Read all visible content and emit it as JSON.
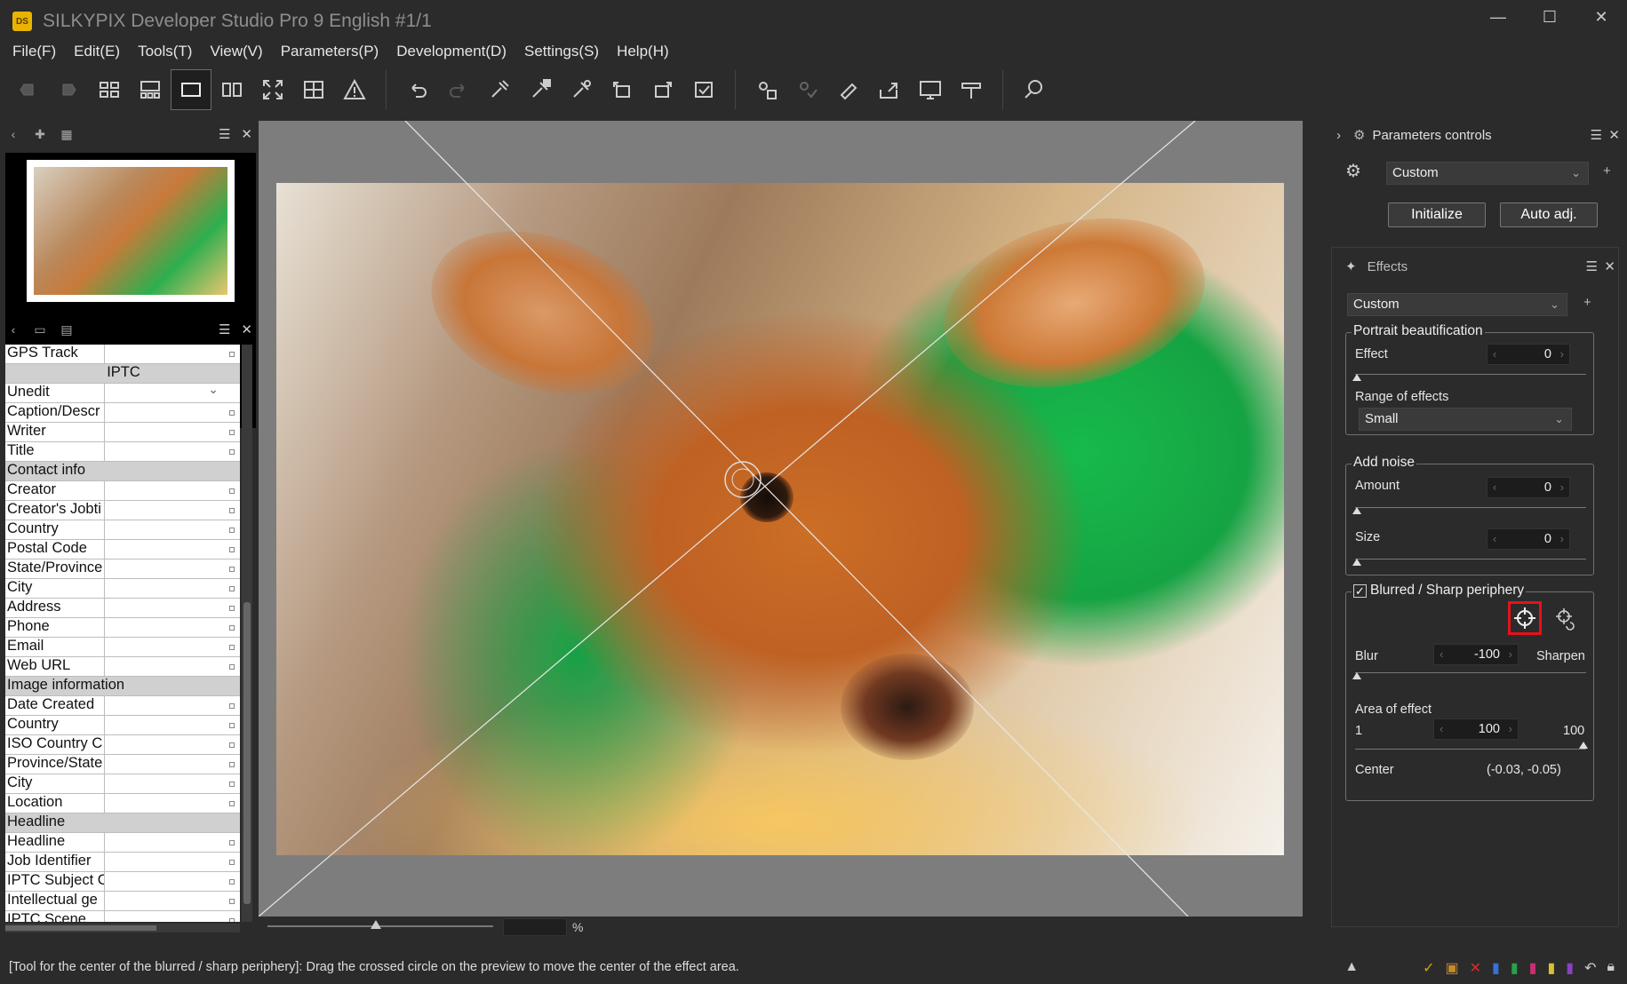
{
  "window": {
    "title": "SILKYPIX Developer Studio Pro 9 English   #1/1",
    "icon_text": "DS",
    "minimize": "—",
    "maximize": "☐",
    "close": "✕"
  },
  "menu": [
    "File(F)",
    "Edit(E)",
    "Tools(T)",
    "View(V)",
    "Parameters(P)",
    "Development(D)",
    "Settings(S)",
    "Help(H)"
  ],
  "left_panel": {
    "metadata_rows": [
      {
        "k": "GPS Track",
        "type": "row"
      },
      {
        "k": "IPTC",
        "type": "center"
      },
      {
        "k": "Unedit",
        "type": "dropdown"
      },
      {
        "k": "Caption/Descr",
        "type": "row"
      },
      {
        "k": "Writer",
        "type": "row"
      },
      {
        "k": "Title",
        "type": "row"
      },
      {
        "k": "Contact info",
        "type": "section"
      },
      {
        "k": "Creator",
        "type": "row"
      },
      {
        "k": "Creator's Jobti",
        "type": "row"
      },
      {
        "k": "Country",
        "type": "row"
      },
      {
        "k": "Postal Code",
        "type": "row"
      },
      {
        "k": "State/Province",
        "type": "row"
      },
      {
        "k": "City",
        "type": "row"
      },
      {
        "k": "Address",
        "type": "row"
      },
      {
        "k": "Phone",
        "type": "row"
      },
      {
        "k": "Email",
        "type": "row"
      },
      {
        "k": "Web URL",
        "type": "row"
      },
      {
        "k": "Image information",
        "type": "section"
      },
      {
        "k": "Date Created",
        "type": "row"
      },
      {
        "k": "Country",
        "type": "row"
      },
      {
        "k": "ISO Country C",
        "type": "row"
      },
      {
        "k": "Province/State",
        "type": "row"
      },
      {
        "k": "City",
        "type": "row"
      },
      {
        "k": "Location",
        "type": "row"
      },
      {
        "k": "Headline",
        "type": "section"
      },
      {
        "k": "Headline",
        "type": "row"
      },
      {
        "k": "Job Identifier",
        "type": "row"
      },
      {
        "k": "IPTC Subject C",
        "type": "row"
      },
      {
        "k": "Intellectual ge",
        "type": "row"
      },
      {
        "k": "IPTC Scene",
        "type": "row"
      }
    ]
  },
  "preview": {
    "zoom_unit": "%"
  },
  "right_panel": {
    "params_title": "Parameters controls",
    "params_preset": "Custom",
    "initialize": "Initialize",
    "auto_adj": "Auto adj.",
    "effects_title": "Effects",
    "effects_preset": "Custom",
    "portrait": {
      "title": "Portrait beautification",
      "effect_label": "Effect",
      "effect_value": "0",
      "range_label": "Range of effects",
      "range_value": "Small"
    },
    "noise": {
      "title": "Add noise",
      "amount_label": "Amount",
      "amount_value": "0",
      "size_label": "Size",
      "size_value": "0"
    },
    "periphery": {
      "title": "Blurred / Sharp periphery",
      "checked": true,
      "blur_label": "Blur",
      "sharpen_label": "Sharpen",
      "blur_value": "-100",
      "area_label": "Area of effect",
      "area_min": "1",
      "area_max": "100",
      "area_value": "100",
      "center_label": "Center",
      "center_value": "(-0.03, -0.05)"
    }
  },
  "status": {
    "text": "[Tool for the center of the blurred / sharp periphery]: Drag the crossed circle on the preview to move the center of the effect area."
  },
  "colors": {
    "highlight": "#e8101a",
    "accent_green": "#22b552"
  }
}
